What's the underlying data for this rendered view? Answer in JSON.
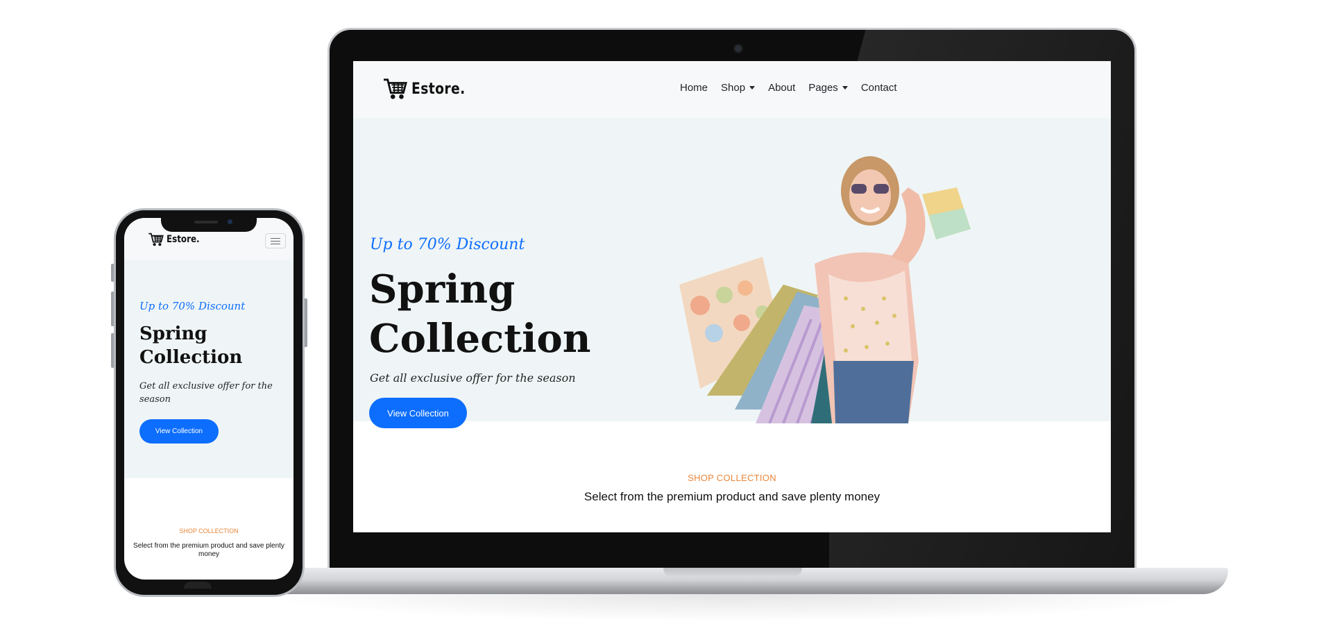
{
  "site": {
    "logo_text": "Estore.",
    "nav": [
      {
        "label": "Home",
        "dropdown": false
      },
      {
        "label": "Shop",
        "dropdown": true
      },
      {
        "label": "About",
        "dropdown": false
      },
      {
        "label": "Pages",
        "dropdown": true
      },
      {
        "label": "Contact",
        "dropdown": false
      }
    ]
  },
  "hero": {
    "tagline": "Up to 70% Discount",
    "title_line1": "Spring",
    "title_line2": "Collection",
    "subtitle": "Get all exclusive offer for the season",
    "button_label": "View Collection"
  },
  "shop_section": {
    "label": "SHOP COLLECTION",
    "title": "Select from the premium product and save plenty money"
  },
  "colors": {
    "primary": "#0d6efd",
    "accent_orange": "#e8863a",
    "hero_bg": "#eff5f6",
    "nav_bg": "#f6f8f9"
  },
  "icons": {
    "logo": "shopping-cart-icon",
    "mobile_menu": "hamburger-menu-icon"
  }
}
